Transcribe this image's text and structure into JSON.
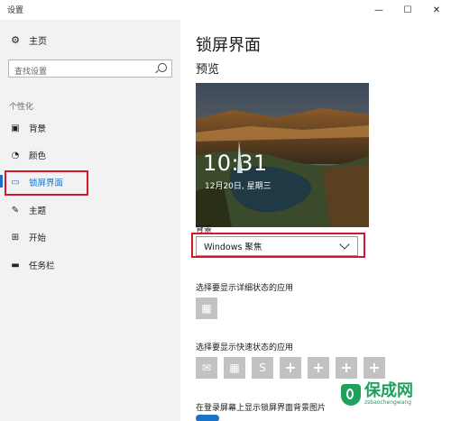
{
  "window": {
    "title": "设置",
    "minimize_glyph": "—",
    "maximize_glyph": "☐",
    "close_glyph": "✕"
  },
  "sidebar": {
    "home_label": "主页",
    "search_placeholder": "查找设置",
    "section_label": "个性化",
    "items": [
      {
        "label": "背景",
        "icon": "image-icon"
      },
      {
        "label": "颜色",
        "icon": "palette-icon"
      },
      {
        "label": "锁屏界面",
        "icon": "lock-screen-icon",
        "active": true
      },
      {
        "label": "主题",
        "icon": "theme-icon"
      },
      {
        "label": "开始",
        "icon": "start-icon"
      },
      {
        "label": "任务栏",
        "icon": "taskbar-icon"
      }
    ]
  },
  "main": {
    "page_title": "锁屏界面",
    "preview_title": "预览",
    "preview_time": "10:31",
    "preview_date": "12月20日, 星期三",
    "background_label": "背景",
    "background_value": "Windows 聚焦",
    "detail_status_label": "选择要显示详细状态的应用",
    "quick_status_label": "选择要显示快速状态的应用",
    "quick_tiles": [
      {
        "icon": "mail-icon",
        "glyph": "✉"
      },
      {
        "icon": "calendar-icon",
        "glyph": "▦"
      },
      {
        "icon": "skype-icon",
        "glyph": "S"
      },
      {
        "icon": "add-icon",
        "glyph": "+"
      },
      {
        "icon": "add-icon",
        "glyph": "+"
      },
      {
        "icon": "add-icon",
        "glyph": "+"
      },
      {
        "icon": "add-icon",
        "glyph": "+"
      }
    ],
    "bottom_label": "在登录屏幕上显示锁屏界面背景图片"
  },
  "watermark": {
    "brand": "保成网",
    "url": "zsbaochengwang"
  },
  "colors": {
    "accent": "#1a73c8",
    "highlight": "#d0192b",
    "tile_gray": "#c2c2c2",
    "watermark_green": "#1ea15d"
  }
}
